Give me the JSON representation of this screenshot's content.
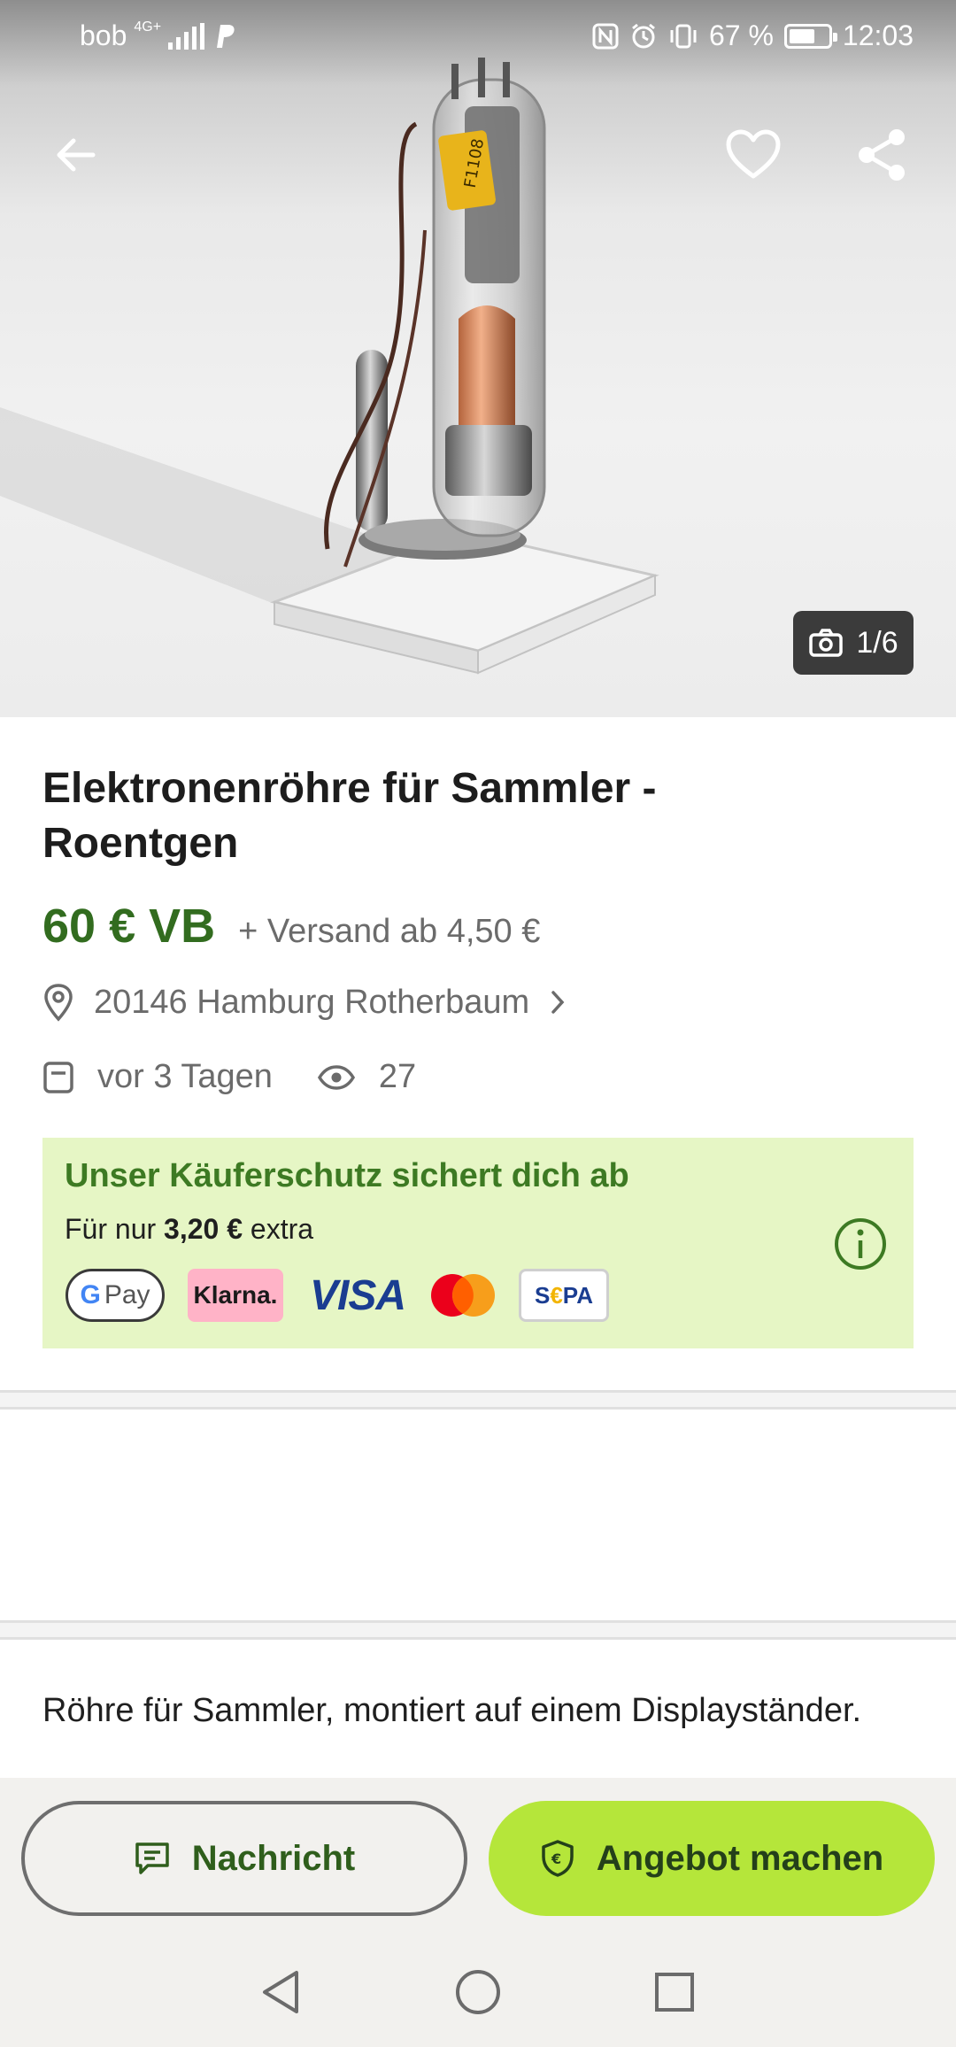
{
  "status_bar": {
    "carrier": "bob",
    "network": "4G+",
    "battery": "67 %",
    "battery_level": 0.67,
    "time": "12:03"
  },
  "gallery": {
    "counter": "1/6"
  },
  "listing": {
    "title": "Elektronenröhre für Sammler - Roentgen",
    "price": "60 € VB",
    "shipping": "+ Versand ab 4,50 €",
    "location": "20146 Hamburg Rotherbaum",
    "posted": "vor 3 Tagen",
    "views": "27"
  },
  "buyer_protection": {
    "heading": "Unser Käuferschutz sichert dich ab",
    "sub_prefix": "Für nur",
    "sub_amount": "3,20 €",
    "sub_suffix": "extra",
    "payment_methods": {
      "gpay": "Pay",
      "klarna": "Klarna.",
      "visa": "VISA",
      "sepa_s": "S",
      "sepa_e": "€",
      "sepa_rest": "PA"
    }
  },
  "description": "Röhre für Sammler, montiert auf einem Displayständer.",
  "actions": {
    "message": "Nachricht",
    "offer": "Angebot machen"
  },
  "colors": {
    "price_green": "#326c1f",
    "protect_bg": "#e6f6c5",
    "offer_button": "#b5e63a"
  }
}
